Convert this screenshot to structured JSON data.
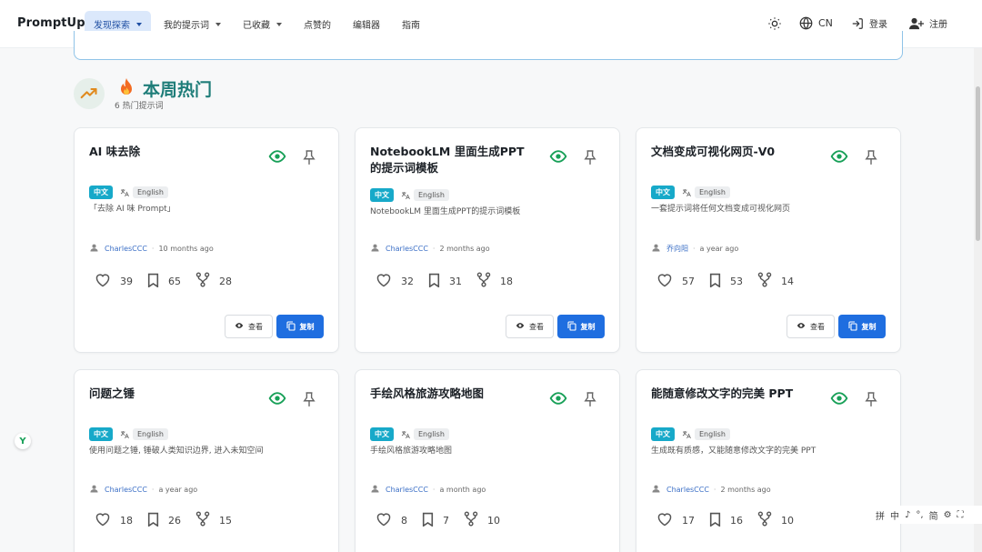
{
  "brand": "PromptUp",
  "nav": [
    {
      "label": "发现探索",
      "dropdown": true,
      "active": true
    },
    {
      "label": "我的提示词",
      "dropdown": true
    },
    {
      "label": "已收藏",
      "dropdown": true
    },
    {
      "label": "点赞的",
      "dropdown": false
    },
    {
      "label": "编辑器",
      "dropdown": false
    },
    {
      "label": "指南",
      "dropdown": false
    }
  ],
  "right_nav": {
    "lang": "CN",
    "login": "登录",
    "register": "注册"
  },
  "section": {
    "title": "本周热门",
    "subtitle": "6 热门提示词"
  },
  "tags": {
    "zh": "中文",
    "en": "English"
  },
  "buttons": {
    "view": "查看",
    "copy": "复制"
  },
  "cards": [
    {
      "title": "AI 味去除",
      "desc": "「去除 AI 味 Prompt」",
      "author": "CharlesCCC",
      "time": "10 months ago",
      "likes": "39",
      "saves": "65",
      "forks": "28"
    },
    {
      "title": "NotebookLM 里面生成PPT的提示词模板",
      "desc": "NotebookLM 里面生成PPT的提示词模板",
      "author": "CharlesCCC",
      "time": "2 months ago",
      "likes": "32",
      "saves": "31",
      "forks": "18"
    },
    {
      "title": "文档变成可视化网页-V0",
      "desc": "一套提示词将任何文档变成可视化网页",
      "author": "乔向阳",
      "time": "a year ago",
      "likes": "57",
      "saves": "53",
      "forks": "14"
    },
    {
      "title": "问题之锤",
      "desc": "使用问题之锤, 锤破人类知识边界, 进入未知空间",
      "author": "CharlesCCC",
      "time": "a year ago",
      "likes": "18",
      "saves": "26",
      "forks": "15"
    },
    {
      "title": "手绘风格旅游攻略地图",
      "desc": "手绘风格旅游攻略地图",
      "author": "CharlesCCC",
      "time": "a month ago",
      "likes": "8",
      "saves": "7",
      "forks": "10"
    },
    {
      "title": "能随意修改文字的完美 PPT",
      "desc": "生成既有质感，又能随意修改文字的完美 PPT",
      "author": "CharlesCCC",
      "time": "2 months ago",
      "likes": "17",
      "saves": "16",
      "forks": "10"
    }
  ],
  "float_logo": "Y",
  "ime": [
    "拼",
    "中",
    "♪",
    "°,",
    "简",
    "⚙",
    "⛶"
  ],
  "colors": {
    "accent": "#1f6ee0",
    "title_teal": "#1f7d79",
    "tag_zh": "#17a9c9",
    "eye_green": "#18a058",
    "nav_active_bg": "#dbe8fb"
  }
}
